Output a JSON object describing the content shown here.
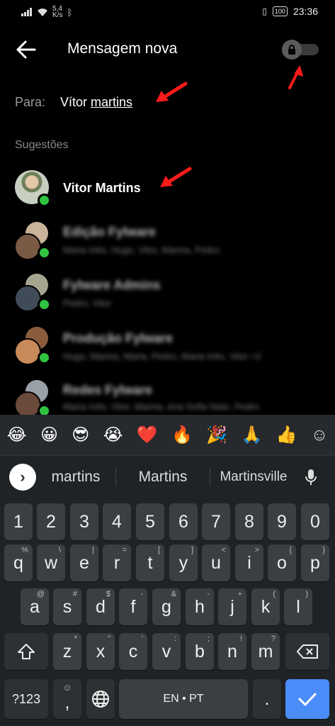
{
  "status_bar": {
    "network_speed": "5,4\nK/s",
    "battery": "100",
    "time": "23:36"
  },
  "header": {
    "title": "Mensagem nova"
  },
  "to_field": {
    "label": "Para:",
    "first": "Vítor",
    "second": "martins"
  },
  "suggestions_label": "Sugestões",
  "suggestions": [
    {
      "name": "Vitor Martins",
      "subtitle": ""
    },
    {
      "name": "Edição Fylware",
      "subtitle": "Maria Inês, Hugo, Vitor, Marina, Pedro"
    },
    {
      "name": "Fylware Admins",
      "subtitle": "Pedro, Vitor"
    },
    {
      "name": "Produção Fylware",
      "subtitle": "Hugo, Marina, Maria, Pedro, Maria Inês, Vitor +2"
    },
    {
      "name": "Redes Fylware",
      "subtitle": "Maria Inês, Vitor, Marina, Ana Sofia Neto, Pedro"
    }
  ],
  "emojis": [
    "😂",
    "😀",
    "😎",
    "😭",
    "❤️",
    "🔥",
    "🎉",
    "🙏",
    "👍",
    "☺"
  ],
  "word_suggestions": [
    "martins",
    "Martins",
    "Martinsville"
  ],
  "keyboard": {
    "row1": [
      "1",
      "2",
      "3",
      "4",
      "5",
      "6",
      "7",
      "8",
      "9",
      "0"
    ],
    "row2": [
      [
        "q",
        "%"
      ],
      [
        "w",
        "\\"
      ],
      [
        "e",
        "|"
      ],
      [
        "r",
        "="
      ],
      [
        "t",
        "["
      ],
      [
        "y",
        "]"
      ],
      [
        "u",
        "<"
      ],
      [
        "i",
        ">"
      ],
      [
        "o",
        "{"
      ],
      [
        "p",
        "}"
      ]
    ],
    "row3": [
      [
        "a",
        "@"
      ],
      [
        "s",
        "#"
      ],
      [
        "d",
        "$"
      ],
      [
        "f",
        "-"
      ],
      [
        "g",
        "&"
      ],
      [
        "h",
        "-"
      ],
      [
        "j",
        "+"
      ],
      [
        "k",
        "("
      ],
      [
        "l",
        ")"
      ]
    ],
    "row4": [
      [
        "z",
        "*"
      ],
      [
        "x",
        "\""
      ],
      [
        "c",
        "'"
      ],
      [
        "v",
        ":"
      ],
      [
        "b",
        ";"
      ],
      [
        "n",
        "!"
      ],
      [
        "m",
        "?"
      ]
    ],
    "symbols_label": "?123",
    "space_label": "EN • PT",
    "period": ".",
    "comma": ","
  },
  "colors": {
    "online": "#31c443",
    "enter_key": "#4b8df8",
    "annotation_arrow": "#ff1a1a"
  }
}
